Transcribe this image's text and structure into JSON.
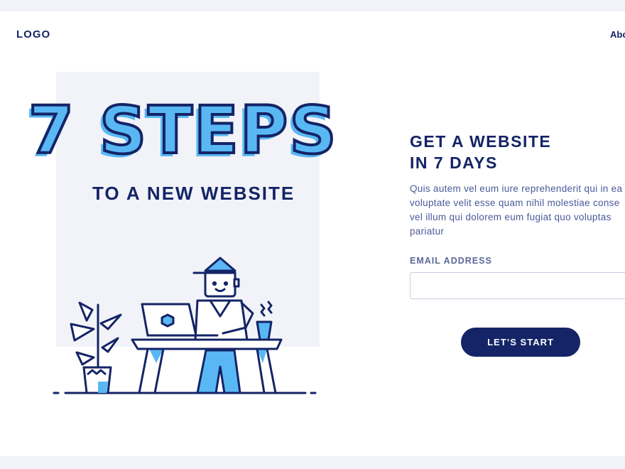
{
  "header": {
    "logo": "LOGO",
    "nav_partial_item": "About"
  },
  "hero": {
    "title": "7 STEPS",
    "subtitle": "TO A NEW WEBSITE"
  },
  "form": {
    "title_line1": "GET A WEBSITE",
    "title_line2": "IN 7 DAYS",
    "description_lines": [
      "Quis autem vel eum iure reprehenderit qui in ea",
      "voluptate velit esse quam nihil molestiae conse",
      "vel illum qui dolorem eum fugiat quo voluptas",
      "pariatur"
    ],
    "email_label": "EMAIL ADDRESS",
    "email_value": "",
    "email_placeholder": "",
    "submit_label": "LET’S START"
  },
  "colors": {
    "navy": "#142466",
    "accent_blue": "#59b8f4",
    "panel_grey": "#f1f3f8",
    "text_muted": "#4b5a9a"
  },
  "icons": [
    "plant-icon",
    "laptop-icon",
    "person-icon",
    "desk-icon",
    "coffee-cup-icon",
    "steam-icon"
  ]
}
